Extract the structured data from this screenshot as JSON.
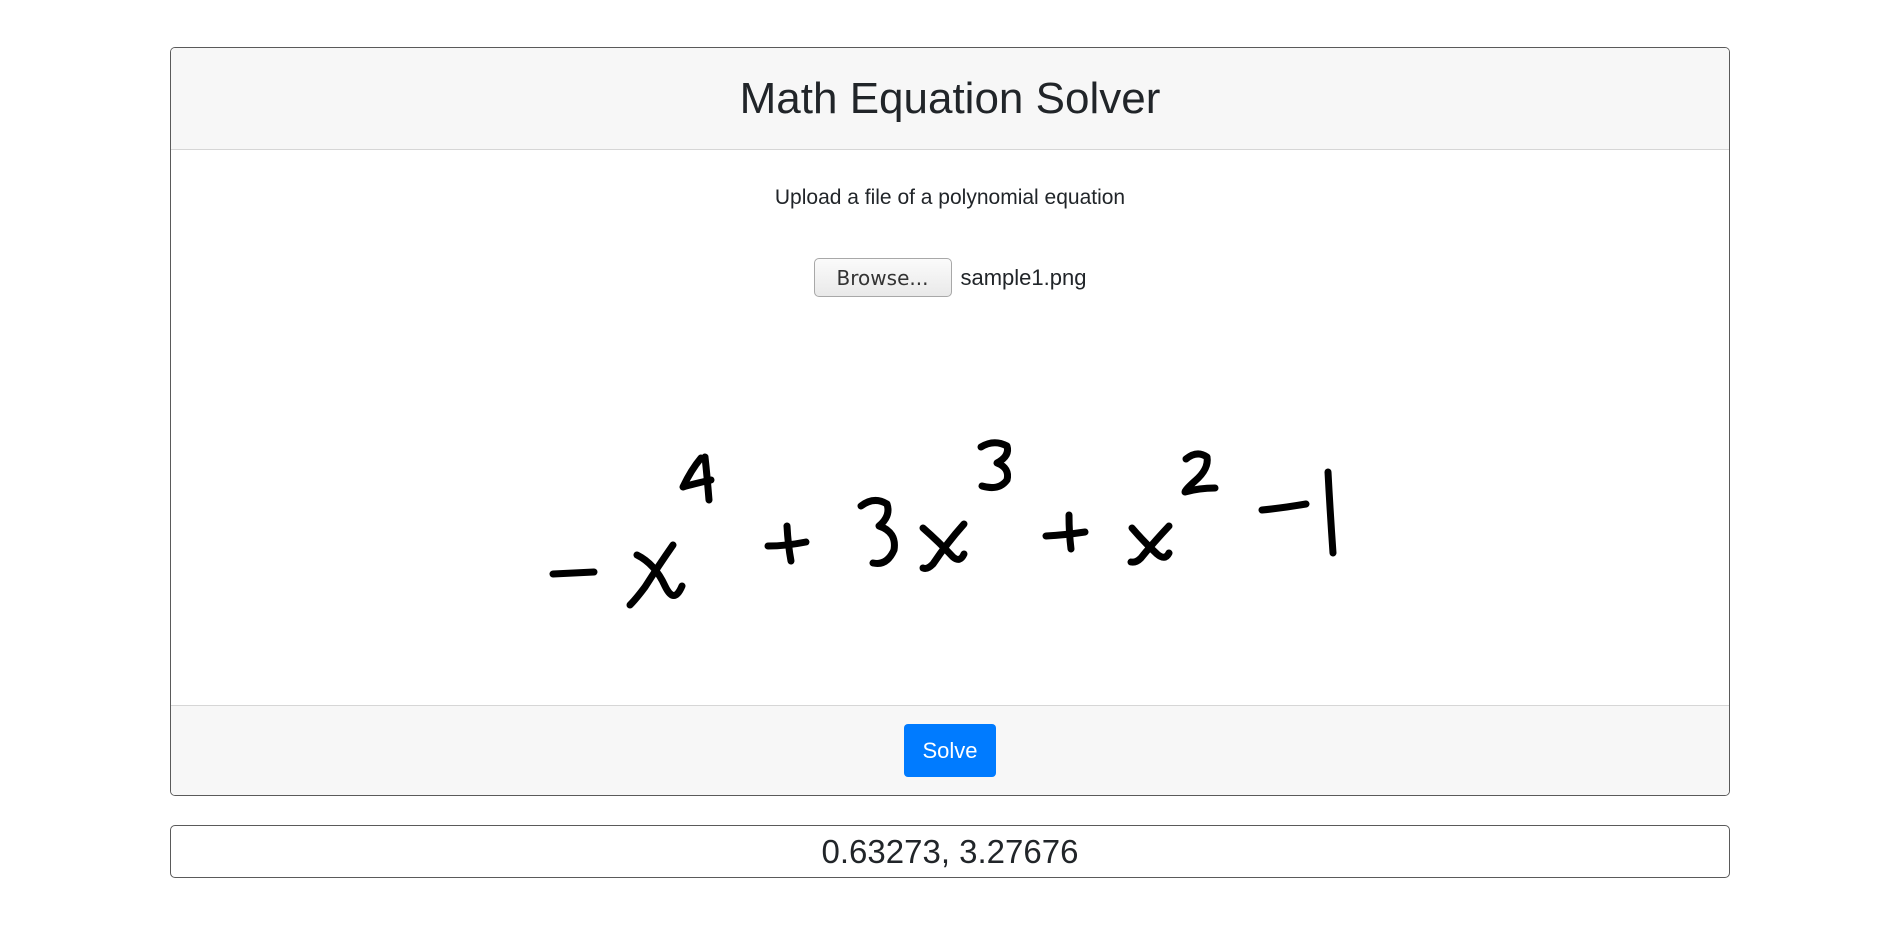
{
  "header": {
    "title": "Math Equation Solver"
  },
  "upload": {
    "prompt": "Upload a file of a polynomial equation",
    "browse_label": "Browse...",
    "file_name": "sample1.png"
  },
  "preview": {
    "icon": "handwritten-equation-image"
  },
  "footer": {
    "solve_label": "Solve"
  },
  "result": {
    "value": "0.63273, 3.27676"
  },
  "colors": {
    "primary": "#007bff",
    "header_bg": "#f7f7f7",
    "border": "#5a5a5a"
  }
}
